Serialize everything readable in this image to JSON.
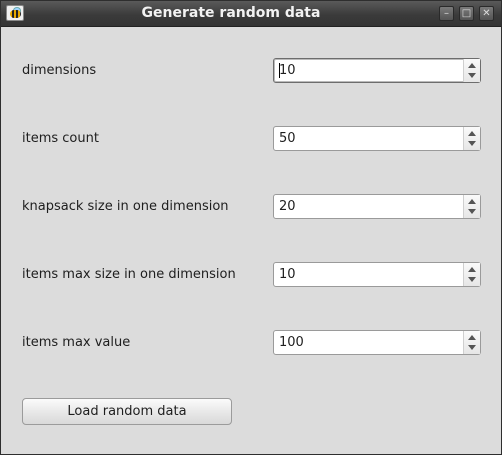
{
  "window": {
    "title": "Generate random data",
    "controls": [
      "minimize",
      "maximize",
      "close"
    ]
  },
  "form": {
    "rows": [
      {
        "label": "dimensions",
        "value": "10"
      },
      {
        "label": "items count",
        "value": "50"
      },
      {
        "label": "knapsack size in one dimension",
        "value": "20"
      },
      {
        "label": "items max size in one dimension",
        "value": "10"
      },
      {
        "label": "items max value",
        "value": "100"
      }
    ],
    "load_button": "Load random data"
  },
  "icons": {
    "app": "bee-icon",
    "minimize": "minimize-icon",
    "maximize": "maximize-icon",
    "close": "close-icon",
    "spin_up": "arrow-up-icon",
    "spin_down": "arrow-down-icon"
  }
}
